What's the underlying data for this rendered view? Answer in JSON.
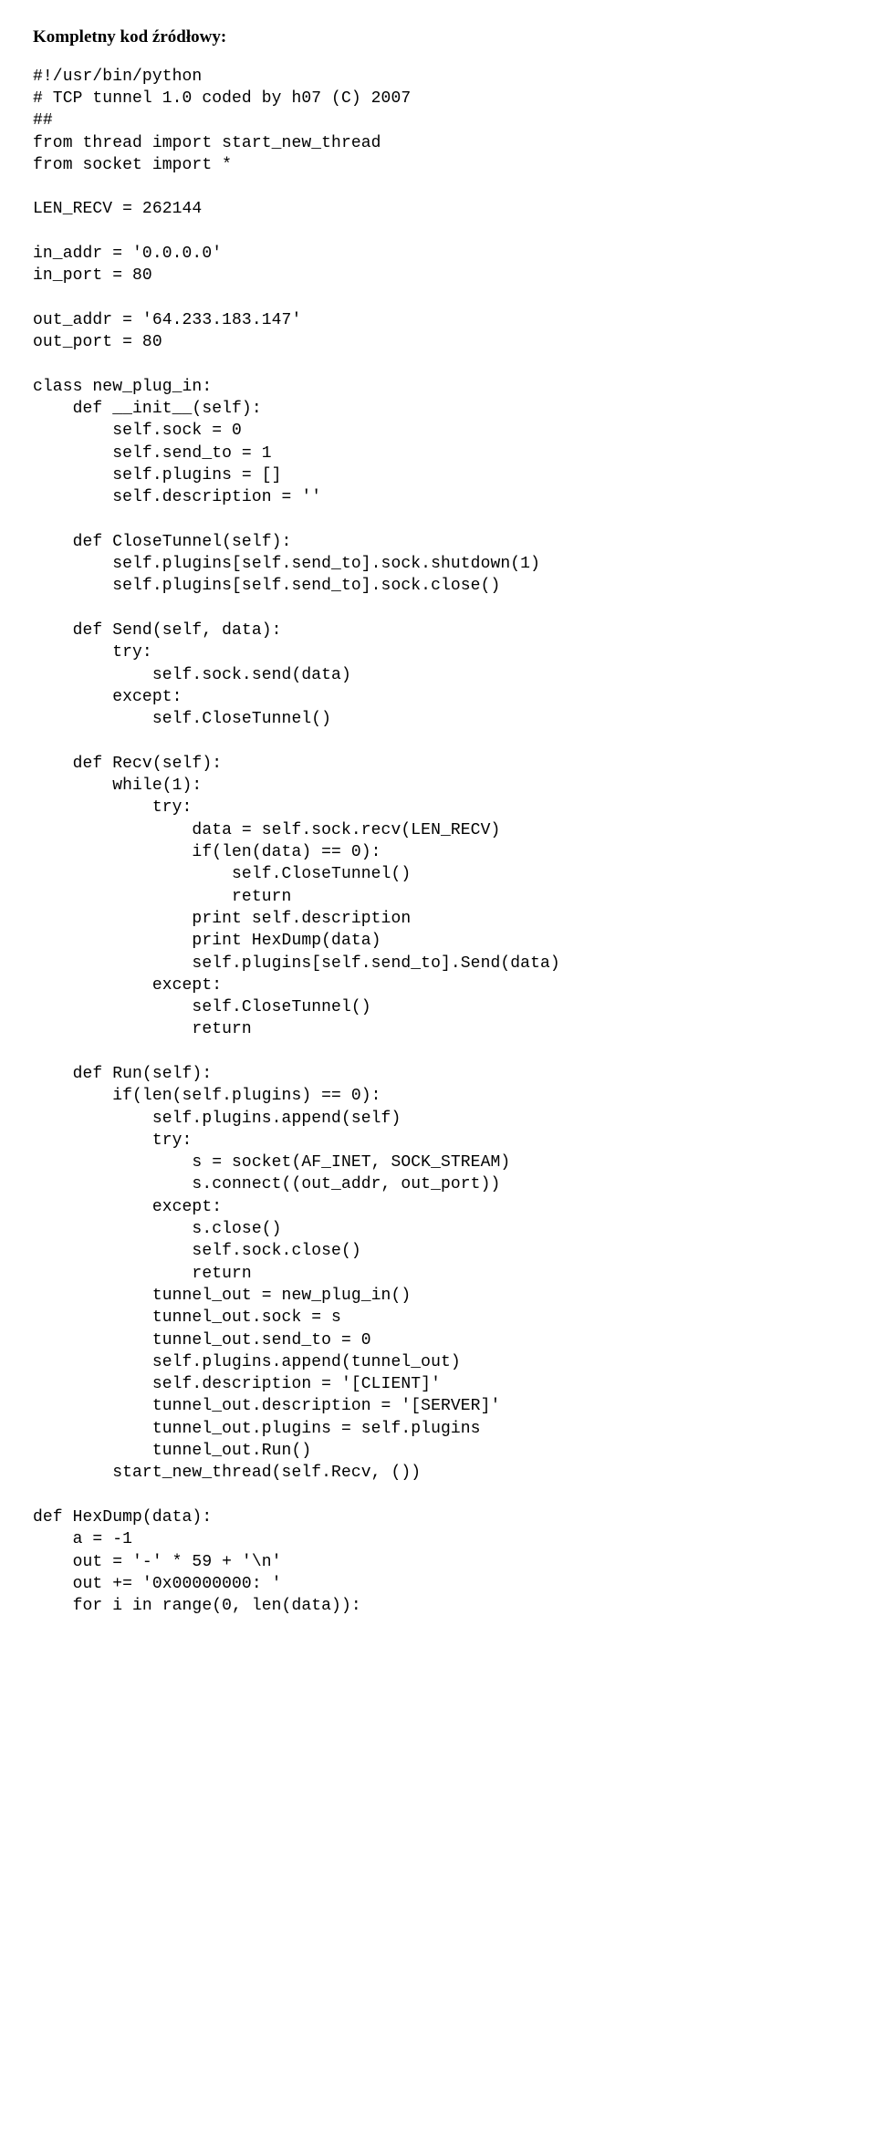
{
  "heading": "Kompletny kod źródłowy:",
  "code": "#!/usr/bin/python\n# TCP tunnel 1.0 coded by h07 (C) 2007\n##\nfrom thread import start_new_thread\nfrom socket import *\n\nLEN_RECV = 262144\n\nin_addr = '0.0.0.0'\nin_port = 80\n\nout_addr = '64.233.183.147'\nout_port = 80\n\nclass new_plug_in:\n    def __init__(self):\n        self.sock = 0\n        self.send_to = 1\n        self.plugins = []\n        self.description = ''\n\n    def CloseTunnel(self):\n        self.plugins[self.send_to].sock.shutdown(1)\n        self.plugins[self.send_to].sock.close()\n\n    def Send(self, data):\n        try:\n            self.sock.send(data)\n        except:\n            self.CloseTunnel()\n\n    def Recv(self):\n        while(1):\n            try:\n                data = self.sock.recv(LEN_RECV)\n                if(len(data) == 0):\n                    self.CloseTunnel()\n                    return\n                print self.description\n                print HexDump(data)\n                self.plugins[self.send_to].Send(data)\n            except:\n                self.CloseTunnel()\n                return\n\n    def Run(self):\n        if(len(self.plugins) == 0):\n            self.plugins.append(self)\n            try:\n                s = socket(AF_INET, SOCK_STREAM)\n                s.connect((out_addr, out_port))\n            except:\n                s.close()\n                self.sock.close()\n                return\n            tunnel_out = new_plug_in()\n            tunnel_out.sock = s\n            tunnel_out.send_to = 0\n            self.plugins.append(tunnel_out)\n            self.description = '[CLIENT]'\n            tunnel_out.description = '[SERVER]'\n            tunnel_out.plugins = self.plugins\n            tunnel_out.Run()\n        start_new_thread(self.Recv, ())\n\ndef HexDump(data):\n    a = -1\n    out = '-' * 59 + '\\n'\n    out += '0x00000000: '\n    for i in range(0, len(data)):"
}
